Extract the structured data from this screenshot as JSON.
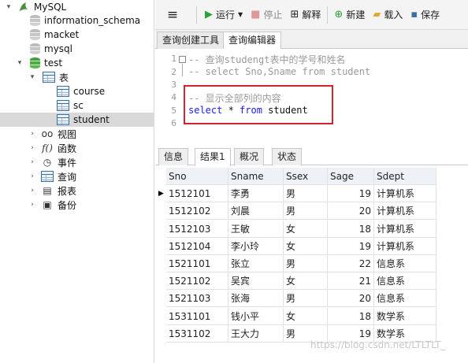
{
  "tree": {
    "root": "MySQL",
    "databases": [
      "information_schema",
      "macket",
      "mysql"
    ],
    "open_db": "test",
    "tables_group": "表",
    "tables": [
      "course",
      "sc",
      "student"
    ],
    "selected_table": "student",
    "groups": [
      "视图",
      "函数",
      "事件",
      "查询",
      "报表",
      "备份"
    ]
  },
  "toolbar": {
    "menu_icon": "hamburger-icon",
    "run": "运行",
    "stop": "停止",
    "explain": "解释",
    "new": "新建",
    "load": "载入",
    "save": "保存"
  },
  "tabs": [
    "查询创建工具",
    "查询编辑器"
  ],
  "editor": {
    "lines": [
      {
        "n": "1",
        "text": "-- 查询studengt表中的学号和姓名"
      },
      {
        "n": "2",
        "text": "-- select Sno,Sname from student"
      },
      {
        "n": "3",
        "text": ""
      },
      {
        "n": "4",
        "text": "-- 显示全部列的内容"
      },
      {
        "n": "5",
        "select": "select",
        "star": " * ",
        "from": "from",
        "table": " student"
      },
      {
        "n": "6",
        "text": ""
      }
    ]
  },
  "result_tabs": [
    "信息",
    "结果1",
    "概况",
    "状态"
  ],
  "grid": {
    "columns": [
      "Sno",
      "Sname",
      "Ssex",
      "Sage",
      "Sdept"
    ],
    "rows": [
      [
        "1512101",
        "李勇",
        "男",
        "19",
        "计算机系"
      ],
      [
        "1512102",
        "刘晨",
        "男",
        "20",
        "计算机系"
      ],
      [
        "1512103",
        "王敏",
        "女",
        "18",
        "计算机系"
      ],
      [
        "1512104",
        "李小玲",
        "女",
        "19",
        "计算机系"
      ],
      [
        "1521101",
        "张立",
        "男",
        "22",
        "信息系"
      ],
      [
        "1521102",
        "吴宾",
        "女",
        "21",
        "信息系"
      ],
      [
        "1521103",
        "张海",
        "男",
        "20",
        "信息系"
      ],
      [
        "1531101",
        "钱小平",
        "女",
        "18",
        "数学系"
      ],
      [
        "1531102",
        "王大力",
        "男",
        "19",
        "数学系"
      ]
    ]
  },
  "watermark": "https://blog.csdn.net/LTLTLT_",
  "colors": {
    "highlight_border": "#d0262b",
    "keyword": "#1a1aff",
    "comment": "#9a9a9a"
  }
}
